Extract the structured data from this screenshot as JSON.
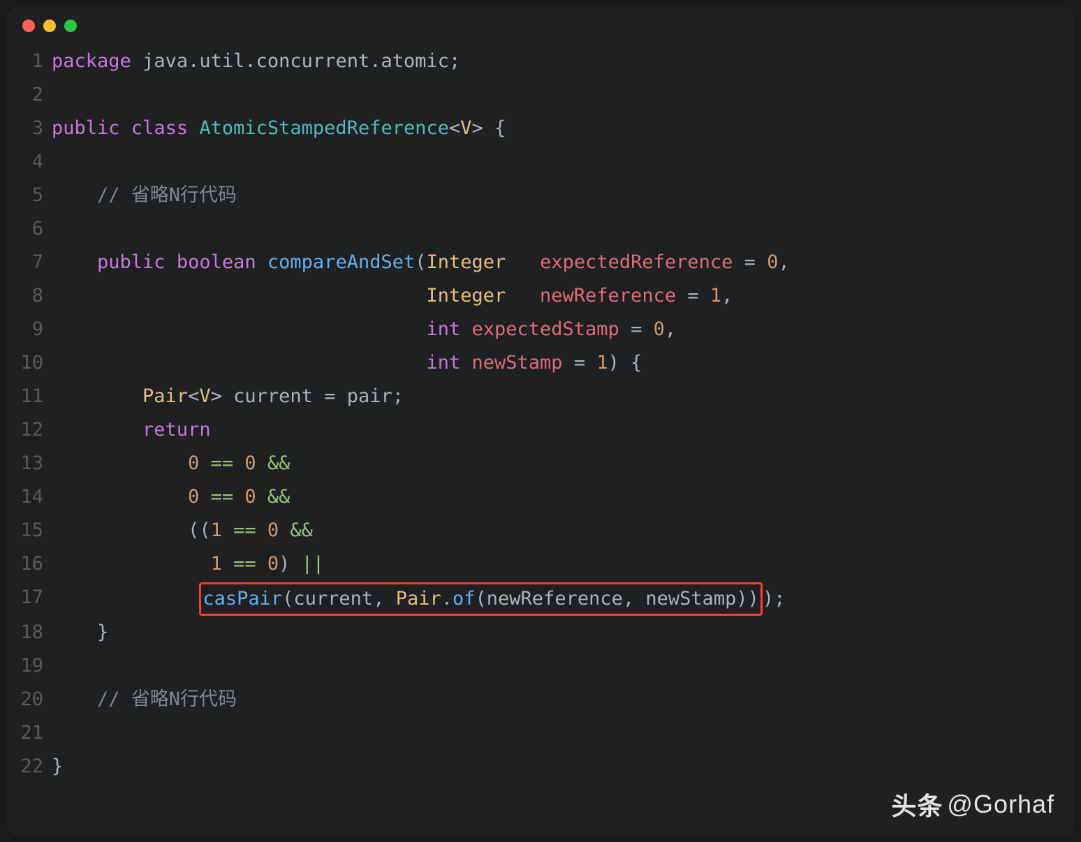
{
  "watermark": {
    "brand": "头条",
    "at": "@Gorhaf"
  },
  "lines": [
    {
      "n": 1,
      "tokens": [
        {
          "c": "kw",
          "t": "package"
        },
        {
          "c": "punc",
          "t": " "
        },
        {
          "c": "id",
          "t": "java"
        },
        {
          "c": "punc",
          "t": "."
        },
        {
          "c": "id",
          "t": "util"
        },
        {
          "c": "punc",
          "t": "."
        },
        {
          "c": "id",
          "t": "concurrent"
        },
        {
          "c": "punc",
          "t": "."
        },
        {
          "c": "id",
          "t": "atomic"
        },
        {
          "c": "punc",
          "t": ";"
        }
      ]
    },
    {
      "n": 2,
      "tokens": []
    },
    {
      "n": 3,
      "tokens": [
        {
          "c": "kw",
          "t": "public"
        },
        {
          "c": "punc",
          "t": " "
        },
        {
          "c": "kw",
          "t": "class"
        },
        {
          "c": "punc",
          "t": " "
        },
        {
          "c": "type",
          "t": "AtomicStampedReference"
        },
        {
          "c": "punc",
          "t": "<"
        },
        {
          "c": "type2",
          "t": "V"
        },
        {
          "c": "punc",
          "t": "> {"
        }
      ]
    },
    {
      "n": 4,
      "tokens": []
    },
    {
      "n": 5,
      "tokens": [
        {
          "c": "punc",
          "t": "    "
        },
        {
          "c": "cmt",
          "t": "// 省略N行代码"
        }
      ]
    },
    {
      "n": 6,
      "tokens": []
    },
    {
      "n": 7,
      "tokens": [
        {
          "c": "punc",
          "t": "    "
        },
        {
          "c": "kw",
          "t": "public"
        },
        {
          "c": "punc",
          "t": " "
        },
        {
          "c": "kw",
          "t": "boolean"
        },
        {
          "c": "punc",
          "t": " "
        },
        {
          "c": "call",
          "t": "compareAndSet"
        },
        {
          "c": "punc",
          "t": "("
        },
        {
          "c": "type2",
          "t": "Integer"
        },
        {
          "c": "punc",
          "t": "   "
        },
        {
          "c": "param",
          "t": "expectedReference"
        },
        {
          "c": "punc",
          "t": " = "
        },
        {
          "c": "orange",
          "t": "0"
        },
        {
          "c": "punc",
          "t": ","
        }
      ]
    },
    {
      "n": 8,
      "tokens": [
        {
          "c": "punc",
          "t": "                                 "
        },
        {
          "c": "type2",
          "t": "Integer"
        },
        {
          "c": "punc",
          "t": "   "
        },
        {
          "c": "param",
          "t": "newReference"
        },
        {
          "c": "punc",
          "t": " = "
        },
        {
          "c": "orange",
          "t": "1"
        },
        {
          "c": "punc",
          "t": ","
        }
      ]
    },
    {
      "n": 9,
      "tokens": [
        {
          "c": "punc",
          "t": "                                 "
        },
        {
          "c": "kw",
          "t": "int"
        },
        {
          "c": "punc",
          "t": " "
        },
        {
          "c": "param",
          "t": "expectedStamp"
        },
        {
          "c": "punc",
          "t": " = "
        },
        {
          "c": "orange",
          "t": "0"
        },
        {
          "c": "punc",
          "t": ","
        }
      ]
    },
    {
      "n": 10,
      "tokens": [
        {
          "c": "punc",
          "t": "                                 "
        },
        {
          "c": "kw",
          "t": "int"
        },
        {
          "c": "punc",
          "t": " "
        },
        {
          "c": "param",
          "t": "newStamp"
        },
        {
          "c": "punc",
          "t": " = "
        },
        {
          "c": "orange",
          "t": "1"
        },
        {
          "c": "punc",
          "t": ") {"
        }
      ]
    },
    {
      "n": 11,
      "tokens": [
        {
          "c": "punc",
          "t": "        "
        },
        {
          "c": "type2",
          "t": "Pair"
        },
        {
          "c": "punc",
          "t": "<"
        },
        {
          "c": "type2",
          "t": "V"
        },
        {
          "c": "punc",
          "t": "> "
        },
        {
          "c": "id",
          "t": "current"
        },
        {
          "c": "punc",
          "t": " = "
        },
        {
          "c": "id",
          "t": "pair"
        },
        {
          "c": "punc",
          "t": ";"
        }
      ]
    },
    {
      "n": 12,
      "tokens": [
        {
          "c": "punc",
          "t": "        "
        },
        {
          "c": "kw",
          "t": "return"
        }
      ]
    },
    {
      "n": 13,
      "tokens": [
        {
          "c": "punc",
          "t": "            "
        },
        {
          "c": "orange",
          "t": "0"
        },
        {
          "c": "punc",
          "t": " "
        },
        {
          "c": "opamp",
          "t": "=="
        },
        {
          "c": "punc",
          "t": " "
        },
        {
          "c": "orange",
          "t": "0"
        },
        {
          "c": "punc",
          "t": " "
        },
        {
          "c": "opamp",
          "t": "&&"
        }
      ]
    },
    {
      "n": 14,
      "tokens": [
        {
          "c": "punc",
          "t": "            "
        },
        {
          "c": "orange",
          "t": "0"
        },
        {
          "c": "punc",
          "t": " "
        },
        {
          "c": "opamp",
          "t": "=="
        },
        {
          "c": "punc",
          "t": " "
        },
        {
          "c": "orange",
          "t": "0"
        },
        {
          "c": "punc",
          "t": " "
        },
        {
          "c": "opamp",
          "t": "&&"
        }
      ]
    },
    {
      "n": 15,
      "tokens": [
        {
          "c": "punc",
          "t": "            (("
        },
        {
          "c": "orange",
          "t": "1"
        },
        {
          "c": "punc",
          "t": " "
        },
        {
          "c": "opamp",
          "t": "=="
        },
        {
          "c": "punc",
          "t": " "
        },
        {
          "c": "orange",
          "t": "0"
        },
        {
          "c": "punc",
          "t": " "
        },
        {
          "c": "opamp",
          "t": "&&"
        }
      ]
    },
    {
      "n": 16,
      "tokens": [
        {
          "c": "punc",
          "t": "              "
        },
        {
          "c": "orange",
          "t": "1"
        },
        {
          "c": "punc",
          "t": " "
        },
        {
          "c": "opamp",
          "t": "=="
        },
        {
          "c": "punc",
          "t": " "
        },
        {
          "c": "orange",
          "t": "0"
        },
        {
          "c": "punc",
          "t": ") "
        },
        {
          "c": "opamp",
          "t": "||"
        }
      ]
    },
    {
      "n": 17,
      "hl": true,
      "pre": [
        {
          "c": "punc",
          "t": "             "
        }
      ],
      "tokens": [
        {
          "c": "call",
          "t": "casPair"
        },
        {
          "c": "punc",
          "t": "("
        },
        {
          "c": "id",
          "t": "current"
        },
        {
          "c": "punc",
          "t": ", "
        },
        {
          "c": "type2",
          "t": "Pair"
        },
        {
          "c": "punc",
          "t": "."
        },
        {
          "c": "call",
          "t": "of"
        },
        {
          "c": "punc",
          "t": "("
        },
        {
          "c": "id",
          "t": "newReference"
        },
        {
          "c": "punc",
          "t": ", "
        },
        {
          "c": "id",
          "t": "newStamp"
        },
        {
          "c": "punc",
          "t": "))"
        }
      ],
      "post": [
        {
          "c": "punc",
          "t": ");"
        }
      ]
    },
    {
      "n": 18,
      "tokens": [
        {
          "c": "punc",
          "t": "    }"
        }
      ]
    },
    {
      "n": 19,
      "tokens": []
    },
    {
      "n": 20,
      "tokens": [
        {
          "c": "punc",
          "t": "    "
        },
        {
          "c": "cmt",
          "t": "// 省略N行代码"
        }
      ]
    },
    {
      "n": 21,
      "tokens": []
    },
    {
      "n": 22,
      "tokens": [
        {
          "c": "punc",
          "t": "}"
        }
      ]
    }
  ]
}
